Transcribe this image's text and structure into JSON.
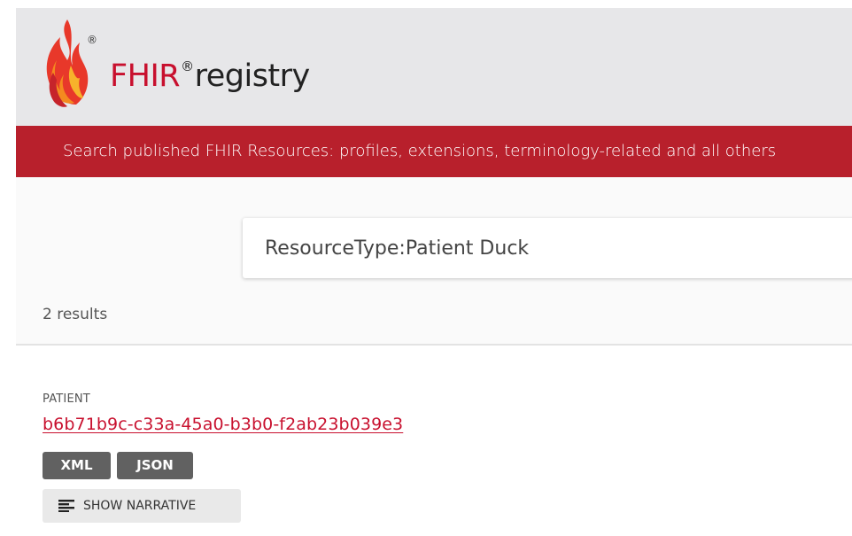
{
  "logo": {
    "fhir": "FHIR",
    "reg_mark": "®",
    "registry": "registry"
  },
  "banner": {
    "text": "Search published FHIR Resources: profiles, extensions, terminology-related and all others"
  },
  "search": {
    "value": "ResourceType:Patient Duck"
  },
  "results": {
    "count_text": "2 results",
    "items": [
      {
        "type_label": "PATIENT",
        "id_link": "b6b71b9c-c33a-45a0-b3b0-f2ab23b039e3",
        "xml_label": "XML",
        "json_label": "JSON",
        "narrative_label": "SHOW NARRATIVE"
      }
    ]
  },
  "colors": {
    "brand_red": "#b8202c",
    "link_red": "#c8102e",
    "header_bg": "#e7e7e9",
    "button_dark": "#616161"
  },
  "icons": {
    "logo": "fhir-flame-logo-icon",
    "narrative": "text-lines-icon"
  }
}
